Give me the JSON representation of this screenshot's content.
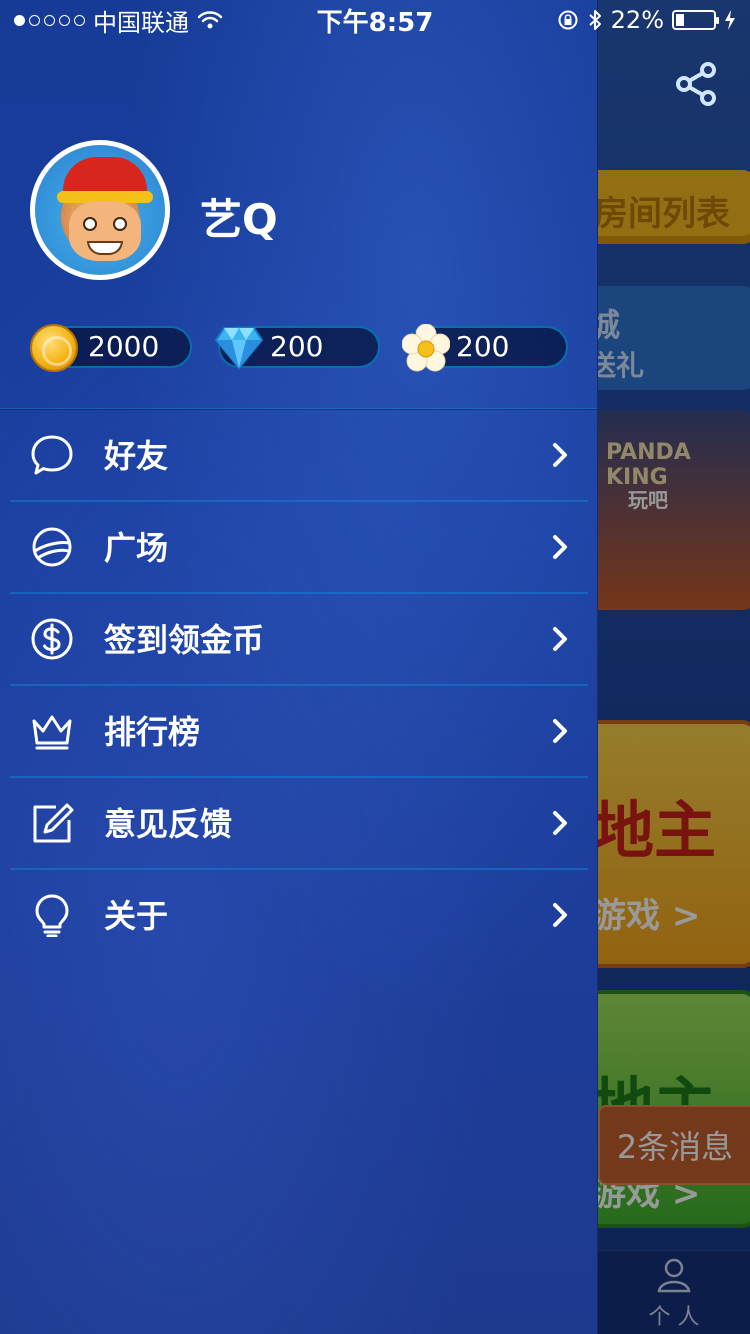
{
  "status_bar": {
    "carrier": "中国联通",
    "time": "下午8:57",
    "battery": "22%",
    "battery_level": 0.22
  },
  "profile": {
    "username": "艺Q"
  },
  "currencies": [
    {
      "name": "coin-icon",
      "value": "2000"
    },
    {
      "name": "diamond-icon",
      "value": "200"
    },
    {
      "name": "flower-icon",
      "value": "200"
    }
  ],
  "menu": [
    {
      "label": "好友",
      "icon": "chat-bubble-icon"
    },
    {
      "label": "广场",
      "icon": "planet-icon"
    },
    {
      "label": "签到领金币",
      "icon": "dollar-icon"
    },
    {
      "label": "排行榜",
      "icon": "crown-icon"
    },
    {
      "label": "意见反馈",
      "icon": "edit-icon"
    },
    {
      "label": "关于",
      "icon": "lightbulb-icon"
    }
  ],
  "background_app": {
    "text_1": "房间列表",
    "text_2": "城",
    "text_3": "送礼",
    "game_1": "PANDA KING",
    "game_1_sub": "玩吧",
    "text_4": "地主",
    "text_5": "游戏 >",
    "text_6": "地主",
    "text_7": "游戏 >",
    "message": "2条消息",
    "tab_label": "个 人"
  },
  "colors": {
    "drawer_bg": "#1a3fa0",
    "pill_bg": "#041035",
    "pill_border": "#00c0ff",
    "divider": "#00aeff",
    "message_bg": "#c2602d"
  }
}
